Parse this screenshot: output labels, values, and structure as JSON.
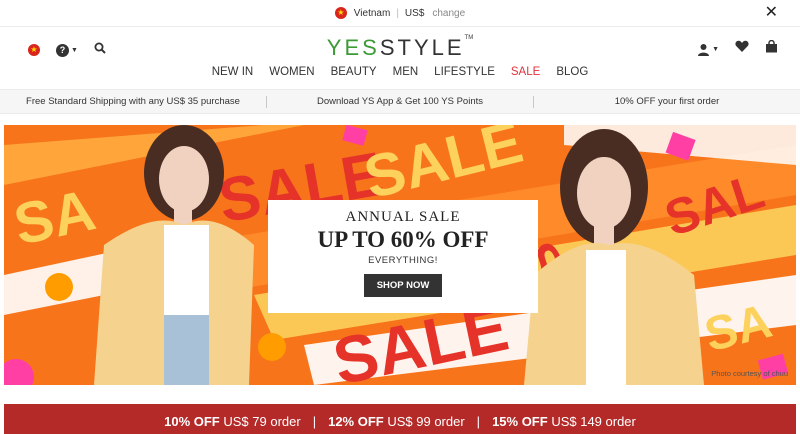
{
  "region": {
    "country": "Vietnam",
    "separator": "|",
    "currency": "US$",
    "change_label": "change",
    "close_icon": "close-icon"
  },
  "logo": {
    "yes": "YES",
    "style": "STYLE",
    "tm": "TM"
  },
  "nav": {
    "items": [
      {
        "label": "NEW IN"
      },
      {
        "label": "WOMEN"
      },
      {
        "label": "BEAUTY"
      },
      {
        "label": "MEN"
      },
      {
        "label": "LIFESTYLE"
      },
      {
        "label": "SALE"
      },
      {
        "label": "BLOG"
      }
    ],
    "sale_color": "#e2323d"
  },
  "promo_strip": [
    "Free Standard Shipping with any US$ 35 purchase",
    "Download YS App & Get 100 YS Points",
    "10% OFF your first order"
  ],
  "hero": {
    "kicker": "ANNUAL SALE",
    "headline": "UP TO 60% OFF",
    "sub": "EVERYTHING!",
    "button": "SHOP NOW",
    "credit": "Photo courtesy of chuu"
  },
  "offers": [
    {
      "pct": "10% OFF",
      "rest": "US$ 79 order"
    },
    {
      "pct": "12% OFF",
      "rest": "US$ 99 order"
    },
    {
      "pct": "15% OFF",
      "rest": "US$ 149 order"
    }
  ],
  "colors": {
    "brand_green": "#3c9b35",
    "offers_red": "#b42a29",
    "banner_orange": "#f7741b"
  }
}
